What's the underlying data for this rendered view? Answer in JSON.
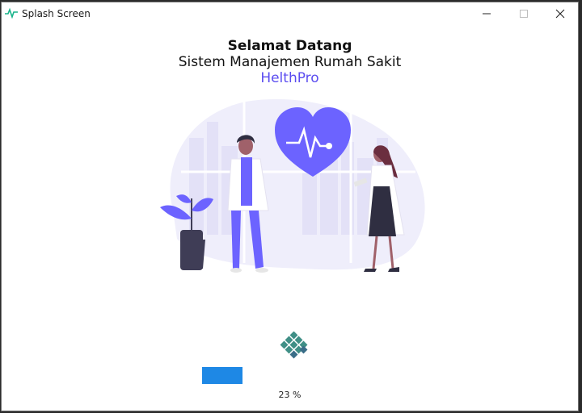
{
  "window": {
    "title": "Splash Screen",
    "app_icon": "heartbeat-icon",
    "controls": [
      "minimize-icon",
      "maximize-icon",
      "close-icon"
    ]
  },
  "heading": {
    "welcome": "Selamat Datang",
    "system": "Sistem Manajemen Rumah Sakit",
    "brand": "HelthPro"
  },
  "loading": {
    "spinner_icon": "diamond-grid-spinner-icon",
    "progress_value": 0.23,
    "progress_text": "23 %"
  },
  "colors": {
    "brand": "#5b4df0",
    "progress": "#1e88e5",
    "spinner": "#3f8f86",
    "illustration_accent": "#6c63ff"
  }
}
